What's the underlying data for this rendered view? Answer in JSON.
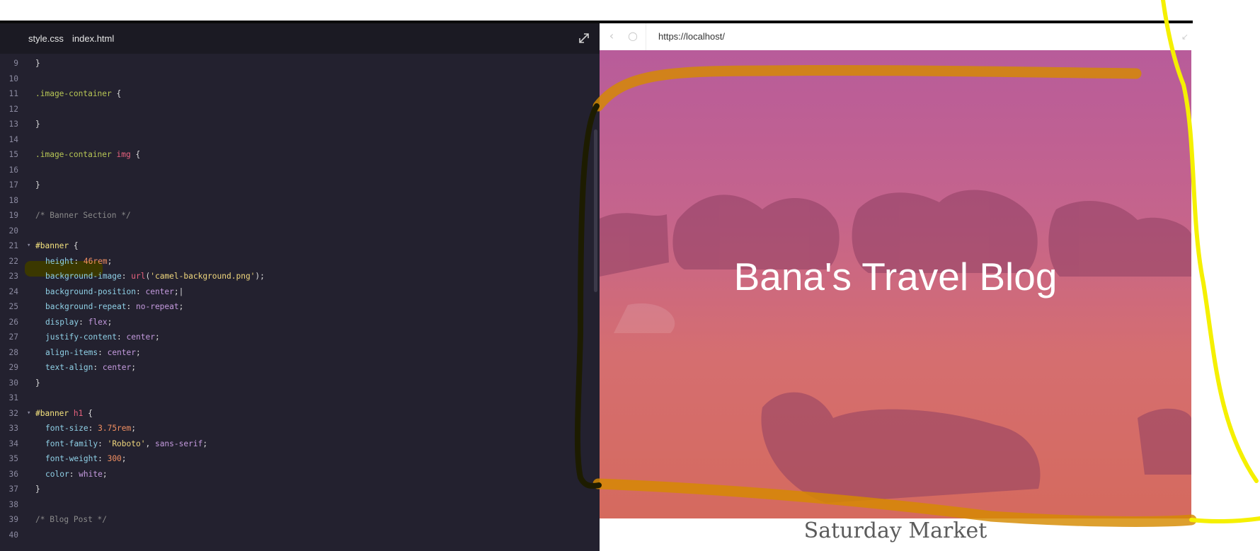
{
  "editor": {
    "tabs": [
      {
        "label": "style.css",
        "active": true
      },
      {
        "label": "index.html",
        "active": false
      }
    ],
    "lines": [
      {
        "n": "9",
        "tokens": [
          {
            "t": "}",
            "c": "punc"
          }
        ]
      },
      {
        "n": "10",
        "tokens": []
      },
      {
        "n": "11",
        "tokens": [
          {
            "t": ".image-container",
            "c": "sel"
          },
          {
            "t": " {",
            "c": "punc"
          }
        ]
      },
      {
        "n": "12",
        "tokens": []
      },
      {
        "n": "13",
        "tokens": [
          {
            "t": "}",
            "c": "punc"
          }
        ]
      },
      {
        "n": "14",
        "tokens": []
      },
      {
        "n": "15",
        "tokens": [
          {
            "t": ".image-container",
            "c": "sel"
          },
          {
            "t": " img",
            "c": "tagc"
          },
          {
            "t": " {",
            "c": "punc"
          }
        ]
      },
      {
        "n": "16",
        "tokens": []
      },
      {
        "n": "17",
        "tokens": [
          {
            "t": "}",
            "c": "punc"
          }
        ]
      },
      {
        "n": "18",
        "tokens": []
      },
      {
        "n": "19",
        "tokens": [
          {
            "t": "/* Banner Section */",
            "c": "cmt"
          }
        ]
      },
      {
        "n": "20",
        "tokens": []
      },
      {
        "n": "21",
        "fold": true,
        "tokens": [
          {
            "t": "#banner",
            "c": "idsel"
          },
          {
            "t": " {",
            "c": "punc"
          }
        ]
      },
      {
        "n": "22",
        "indent": true,
        "tokens": [
          {
            "t": "height",
            "c": "prop"
          },
          {
            "t": ": ",
            "c": "punc"
          },
          {
            "t": "46rem",
            "c": "num"
          },
          {
            "t": ";",
            "c": "punc"
          }
        ]
      },
      {
        "n": "23",
        "indent": true,
        "tokens": [
          {
            "t": "background-image",
            "c": "prop"
          },
          {
            "t": ": ",
            "c": "punc"
          },
          {
            "t": "url",
            "c": "tagc"
          },
          {
            "t": "(",
            "c": "punc"
          },
          {
            "t": "'camel-background.png'",
            "c": "str"
          },
          {
            "t": ");",
            "c": "punc"
          }
        ]
      },
      {
        "n": "24",
        "indent": true,
        "tokens": [
          {
            "t": "background-position",
            "c": "prop"
          },
          {
            "t": ": ",
            "c": "punc"
          },
          {
            "t": "center",
            "c": "kw"
          },
          {
            "t": ";|",
            "c": "punc"
          }
        ]
      },
      {
        "n": "25",
        "indent": true,
        "tokens": [
          {
            "t": "background-repeat",
            "c": "prop"
          },
          {
            "t": ": ",
            "c": "punc"
          },
          {
            "t": "no-repeat",
            "c": "kw"
          },
          {
            "t": ";",
            "c": "punc"
          }
        ]
      },
      {
        "n": "26",
        "indent": true,
        "tokens": [
          {
            "t": "display",
            "c": "prop"
          },
          {
            "t": ": ",
            "c": "punc"
          },
          {
            "t": "flex",
            "c": "kw"
          },
          {
            "t": ";",
            "c": "punc"
          }
        ]
      },
      {
        "n": "27",
        "indent": true,
        "tokens": [
          {
            "t": "justify-content",
            "c": "prop"
          },
          {
            "t": ": ",
            "c": "punc"
          },
          {
            "t": "center",
            "c": "kw"
          },
          {
            "t": ";",
            "c": "punc"
          }
        ]
      },
      {
        "n": "28",
        "indent": true,
        "tokens": [
          {
            "t": "align-items",
            "c": "prop"
          },
          {
            "t": ": ",
            "c": "punc"
          },
          {
            "t": "center",
            "c": "kw"
          },
          {
            "t": ";",
            "c": "punc"
          }
        ]
      },
      {
        "n": "29",
        "indent": true,
        "tokens": [
          {
            "t": "text-align",
            "c": "prop"
          },
          {
            "t": ": ",
            "c": "punc"
          },
          {
            "t": "center",
            "c": "kw"
          },
          {
            "t": ";",
            "c": "punc"
          }
        ]
      },
      {
        "n": "30",
        "tokens": [
          {
            "t": "}",
            "c": "punc"
          }
        ]
      },
      {
        "n": "31",
        "tokens": []
      },
      {
        "n": "32",
        "fold": true,
        "tokens": [
          {
            "t": "#banner",
            "c": "idsel"
          },
          {
            "t": " h1",
            "c": "tagc"
          },
          {
            "t": " {",
            "c": "punc"
          }
        ]
      },
      {
        "n": "33",
        "indent": true,
        "tokens": [
          {
            "t": "font-size",
            "c": "prop"
          },
          {
            "t": ": ",
            "c": "punc"
          },
          {
            "t": "3.75rem",
            "c": "num"
          },
          {
            "t": ";",
            "c": "punc"
          }
        ]
      },
      {
        "n": "34",
        "indent": true,
        "tokens": [
          {
            "t": "font-family",
            "c": "prop"
          },
          {
            "t": ": ",
            "c": "punc"
          },
          {
            "t": "'Roboto'",
            "c": "str"
          },
          {
            "t": ", ",
            "c": "punc"
          },
          {
            "t": "sans-serif",
            "c": "kw"
          },
          {
            "t": ";",
            "c": "punc"
          }
        ]
      },
      {
        "n": "35",
        "indent": true,
        "tokens": [
          {
            "t": "font-weight",
            "c": "prop"
          },
          {
            "t": ": ",
            "c": "punc"
          },
          {
            "t": "300",
            "c": "num"
          },
          {
            "t": ";",
            "c": "punc"
          }
        ]
      },
      {
        "n": "36",
        "indent": true,
        "tokens": [
          {
            "t": "color",
            "c": "prop"
          },
          {
            "t": ": ",
            "c": "punc"
          },
          {
            "t": "white",
            "c": "kw"
          },
          {
            "t": ";",
            "c": "punc"
          }
        ]
      },
      {
        "n": "37",
        "tokens": [
          {
            "t": "}",
            "c": "punc"
          }
        ]
      },
      {
        "n": "38",
        "tokens": []
      },
      {
        "n": "39",
        "tokens": [
          {
            "t": "/* Blog Post */",
            "c": "cmt"
          }
        ]
      },
      {
        "n": "40",
        "tokens": []
      }
    ]
  },
  "browser": {
    "url": "https://localhost/",
    "banner_title": "Bana's Travel Blog",
    "post_title": "Saturday Market"
  },
  "colors": {
    "editor_bg": "#23212f",
    "annotation_yellow": "#f5f000",
    "annotation_orange": "#d68a00",
    "annotation_dark": "#1d1c00"
  }
}
